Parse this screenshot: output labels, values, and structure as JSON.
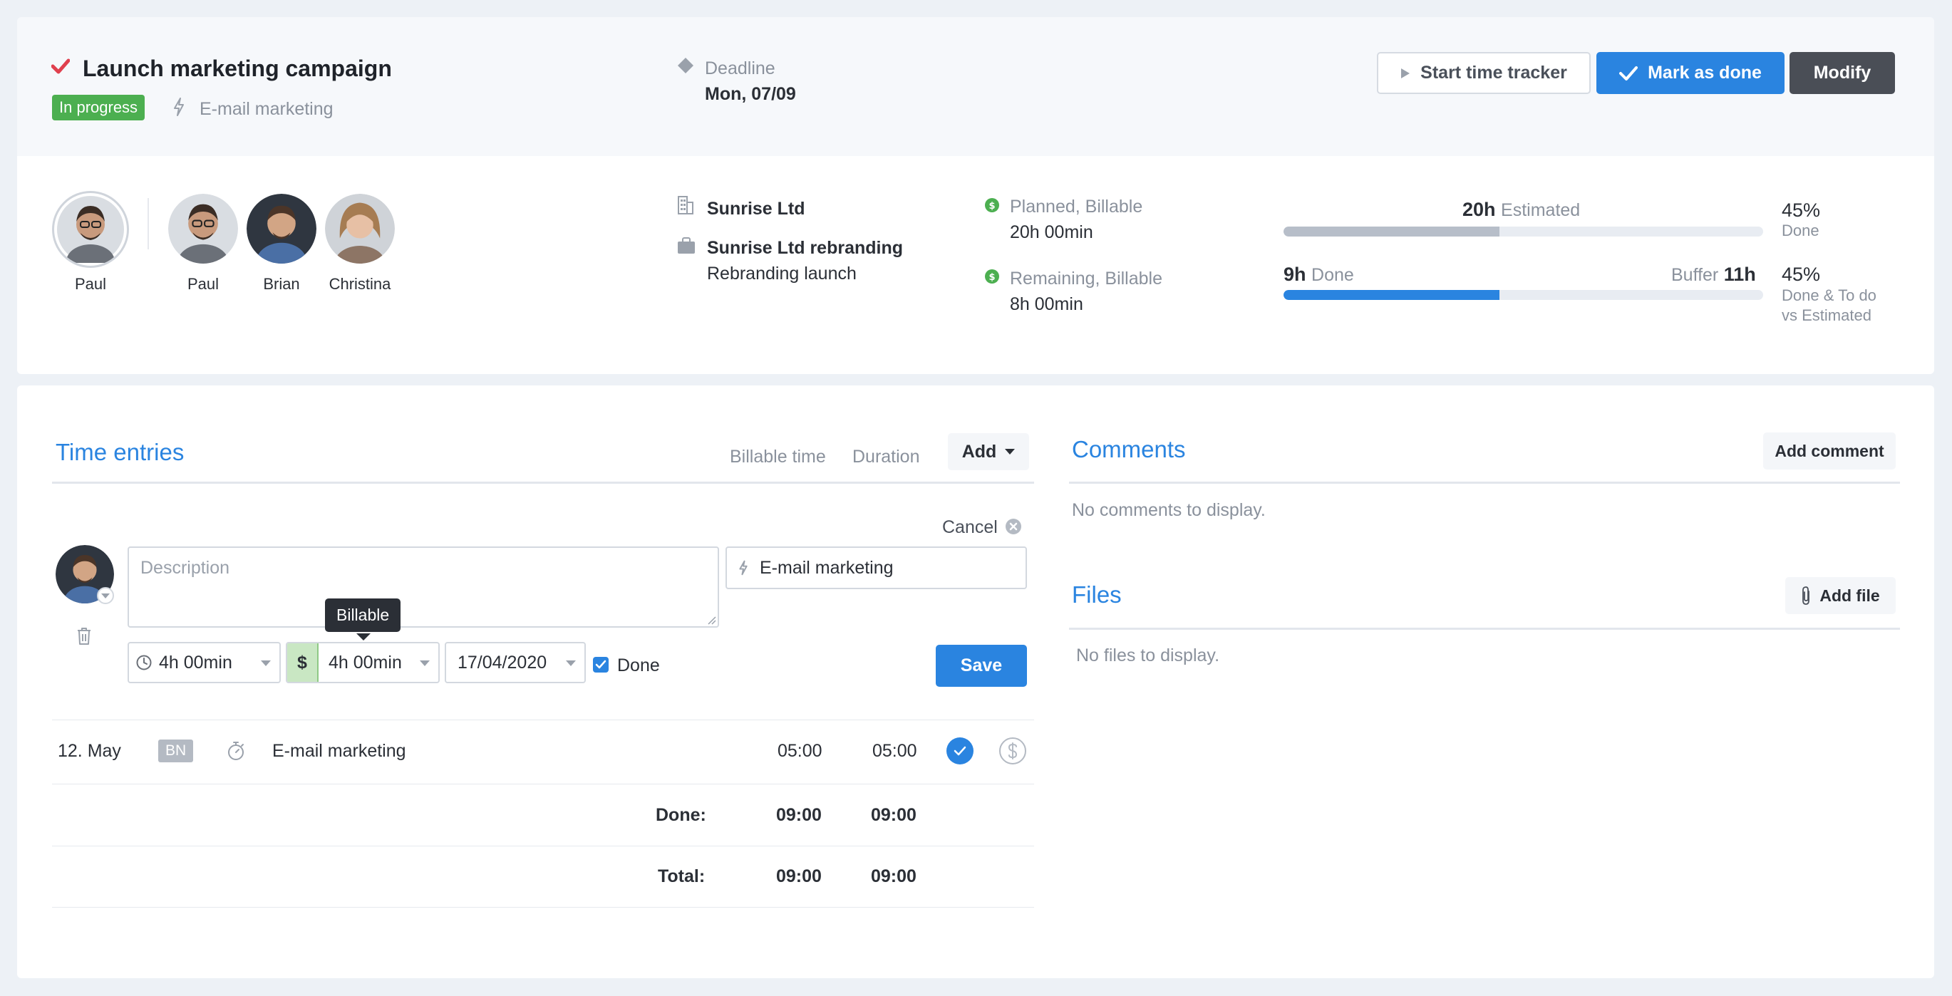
{
  "task": {
    "title": "Launch marketing campaign",
    "status": "In progress",
    "category": "E-mail marketing",
    "deadline_label": "Deadline",
    "deadline_value": "Mon, 07/09"
  },
  "toolbar": {
    "start_tracker": "Start time tracker",
    "mark_done": "Mark as done",
    "modify": "Modify"
  },
  "people": {
    "owner": "Paul",
    "members": [
      "Paul",
      "Brian",
      "Christina"
    ]
  },
  "client": {
    "company": "Sunrise Ltd",
    "project": "Sunrise Ltd rebranding",
    "milestone": "Rebranding launch"
  },
  "budget": {
    "planned_label": "Planned, Billable",
    "planned_value": "20h 00min",
    "remaining_label": "Remaining, Billable",
    "remaining_value": "8h 00min",
    "estimated_hours": "20h",
    "estimated_label": "Estimated",
    "estimated_progress": 0.45,
    "done_hours": "9h",
    "done_label": "Done",
    "buffer_label": "Buffer",
    "buffer_hours": "11h",
    "done_progress": 0.45,
    "pct1": "45%",
    "pct1_label": "Done",
    "pct2": "45%",
    "pct2_label_1": "Done & To do",
    "pct2_label_2": "vs Estimated"
  },
  "time_entries": {
    "title": "Time entries",
    "col_billable": "Billable time",
    "col_duration": "Duration",
    "add_label": "Add",
    "cancel_label": "Cancel",
    "form": {
      "description_placeholder": "Description",
      "activity": "E-mail marketing",
      "duration": "4h 00min",
      "billable_symbol": "$",
      "billable_duration": "4h 00min",
      "date": "17/04/2020",
      "done_label": "Done",
      "done_checked": true,
      "tooltip": "Billable",
      "save_label": "Save"
    },
    "rows": [
      {
        "date": "12. May",
        "initials": "BN",
        "activity": "E-mail marketing",
        "billable": "05:00",
        "duration": "05:00"
      }
    ],
    "done_row": {
      "label": "Done:",
      "billable": "09:00",
      "duration": "09:00"
    },
    "total_row": {
      "label": "Total:",
      "billable": "09:00",
      "duration": "09:00"
    }
  },
  "comments": {
    "title": "Comments",
    "add_label": "Add comment",
    "empty": "No comments to display."
  },
  "files": {
    "title": "Files",
    "add_label": "Add file",
    "empty": "No files to display."
  },
  "colors": {
    "accent": "#2a84e0",
    "success": "#4caf50",
    "danger": "#e0404e"
  }
}
